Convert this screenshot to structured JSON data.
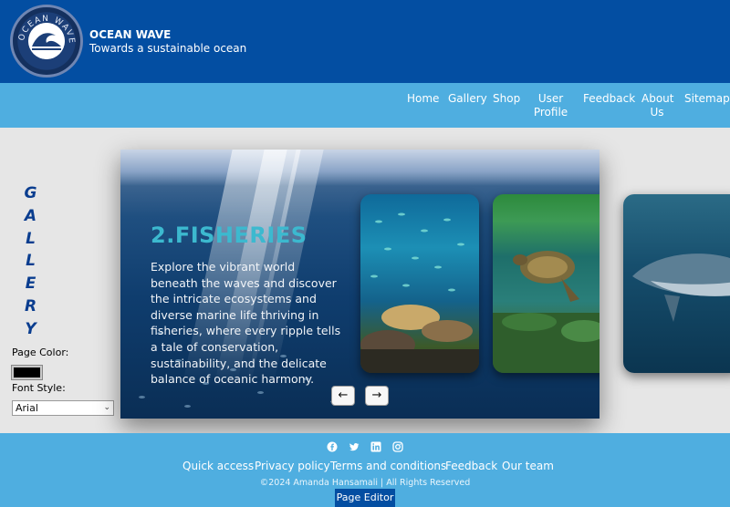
{
  "header": {
    "brand_title": "OCEAN WAVE",
    "brand_subtitle": "Towards a sustainable ocean",
    "logo_text": "OCEAN WAVE"
  },
  "nav": {
    "items": [
      {
        "label": "Home"
      },
      {
        "label": "Gallery"
      },
      {
        "label": "Shop"
      },
      {
        "label": "User Profile"
      },
      {
        "label": "Feedback"
      },
      {
        "label": "About Us"
      },
      {
        "label": "Sitemap"
      }
    ]
  },
  "sidebar": {
    "gallery_letters": [
      "G",
      "A",
      "L",
      "L",
      "E",
      "R",
      "Y"
    ],
    "page_color_label": "Page Color:",
    "page_color_value": "#000000",
    "font_style_label": "Font Style:",
    "font_style_value": "Arial"
  },
  "slider": {
    "heading": "2.FISHERIES",
    "text": "Explore the vibrant world beneath the waves and discover the intricate ecosystems and diverse marine life thriving in fisheries, where every ripple tells a tale of conservation, sustainability, and the delicate balance of oceanic harmony.",
    "prev_label": "←",
    "next_label": "→"
  },
  "footer": {
    "social_icons": [
      "facebook-icon",
      "twitter-icon",
      "linkedin-icon",
      "instagram-icon"
    ],
    "links": [
      {
        "label": "Quick access"
      },
      {
        "label": "Privacy policy"
      },
      {
        "label": "Terms and conditions"
      },
      {
        "label": "Feedback"
      },
      {
        "label": "Our team"
      }
    ],
    "copyright": "©2024 Amanda Hansamali | All Rights Reserved",
    "page_editor_label": "Page Editor"
  },
  "colors": {
    "header_bg": "#034ea2",
    "nav_bg": "#4faee0",
    "heading_accent": "#3cb9cf",
    "gallery_text": "#0a3d8f"
  }
}
